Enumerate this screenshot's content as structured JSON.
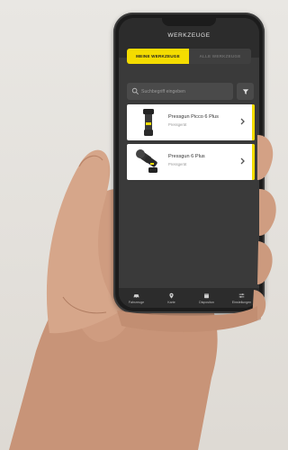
{
  "app": {
    "title": "WERKZEUGE"
  },
  "tabs": [
    {
      "label": "MEINE WERKZEUGE",
      "active": true
    },
    {
      "label": "ALLE WERKZEUGE",
      "active": false
    }
  ],
  "search": {
    "placeholder": "Suchbegriff eingeben"
  },
  "tools": [
    {
      "name": "Pressgun Picco 6 Plus",
      "category": "Pressgerät"
    },
    {
      "name": "Pressgun 6 Plus",
      "category": "Pressgerät"
    }
  ],
  "bottom_nav": [
    {
      "label": "Fahrzeuge",
      "icon": "car-icon"
    },
    {
      "label": "Karte",
      "icon": "map-pin-icon"
    },
    {
      "label": "Dispositon",
      "icon": "calendar-icon"
    },
    {
      "label": "Einstellungen",
      "icon": "sliders-icon"
    }
  ],
  "colors": {
    "accent": "#f4dc00",
    "screen_bg": "#3a3a3a",
    "bar_bg": "#2c2c2c"
  }
}
